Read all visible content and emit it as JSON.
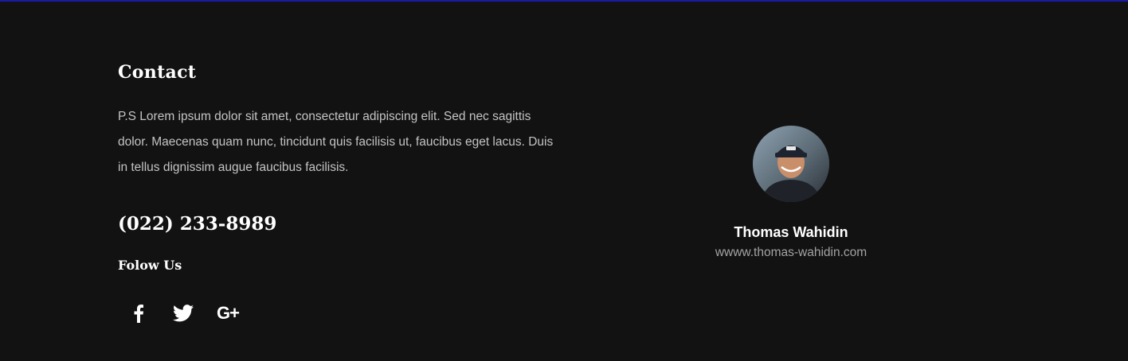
{
  "contact": {
    "heading": "Contact",
    "description": "P.S Lorem ipsum dolor sit amet, consectetur adipiscing elit. Sed nec sagittis dolor. Maecenas quam nunc, tincidunt quis facilisis ut, faucibus eget lacus. Duis in tellus dignissim augue faucibus facilisis.",
    "phone": "(022) 233-8989",
    "follow_label": "Folow Us",
    "social": [
      {
        "icon": "facebook-icon"
      },
      {
        "icon": "twitter-icon"
      },
      {
        "icon": "google-plus-icon",
        "glyph": "G+"
      }
    ]
  },
  "profile": {
    "name": "Thomas Wahidin",
    "website": "wwww.thomas-wahidin.com"
  },
  "colors": {
    "background": "#131213",
    "top_border": "#1a1aa8",
    "heading": "#ffffff",
    "body_text": "#c4c4c4",
    "muted_text": "#a3a3a3"
  }
}
